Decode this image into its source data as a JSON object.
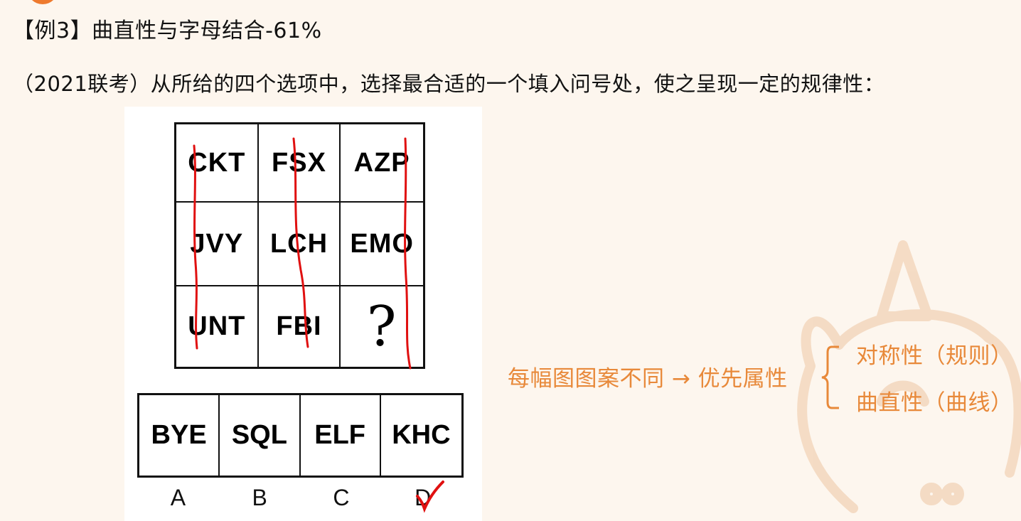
{
  "header": {
    "title": "【例3】曲直性与字母结合-61%",
    "question": "（2021联考）从所给的四个选项中，选择最合适的一个填入问号处，使之呈现一定的规律性："
  },
  "grid": {
    "rows": [
      [
        "CKT",
        "FSX",
        "AZP"
      ],
      [
        "JVY",
        "LCH",
        "EMO"
      ],
      [
        "UNT",
        "FBI",
        "?"
      ]
    ]
  },
  "options": {
    "items": [
      "BYE",
      "SQL",
      "ELF",
      "KHC"
    ],
    "labels": [
      "A",
      "B",
      "C",
      "D"
    ],
    "answer": "D"
  },
  "notes": {
    "main": "每幅图图案不同 → 优先属性",
    "branch1": "对称性（规则）",
    "branch2": "曲直性（曲线）"
  },
  "colors": {
    "accent": "#e8893a",
    "pen": "#e01010",
    "background": "#fdf6ee"
  }
}
